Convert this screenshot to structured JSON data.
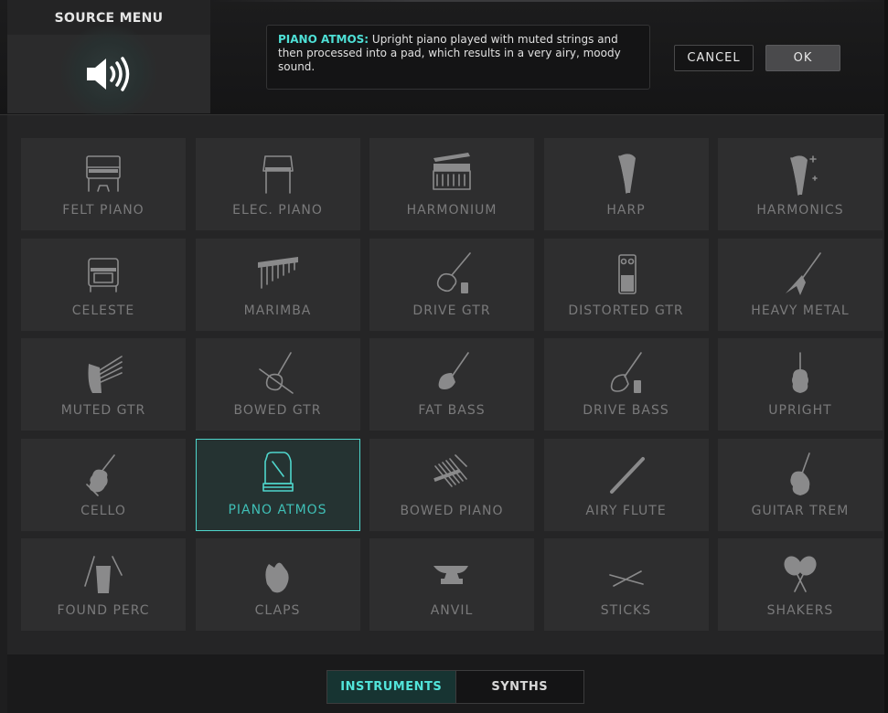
{
  "header": {
    "source_title": "SOURCE MENU",
    "source_icon": "speaker-icon",
    "description_name": "PIANO ATMOS:",
    "description_text": " Upright piano played with muted strings and then processed into a pad, which results in a very airy, moody sound.",
    "cancel_label": "CANCEL",
    "ok_label": "OK"
  },
  "grid": {
    "selected": "PIANO ATMOS",
    "tiles": [
      {
        "label": "FELT PIANO",
        "icon": "upright-piano-icon"
      },
      {
        "label": "ELEC. PIANO",
        "icon": "electric-piano-icon"
      },
      {
        "label": "HARMONIUM",
        "icon": "harmonium-icon"
      },
      {
        "label": "HARP",
        "icon": "harp-icon"
      },
      {
        "label": "HARMONICS",
        "icon": "harp-sparkle-icon"
      },
      {
        "label": "CELESTE",
        "icon": "celeste-icon"
      },
      {
        "label": "MARIMBA",
        "icon": "marimba-icon"
      },
      {
        "label": "DRIVE GTR",
        "icon": "electric-guitar-pedal-icon"
      },
      {
        "label": "DISTORTED GTR",
        "icon": "distortion-pedal-icon"
      },
      {
        "label": "HEAVY METAL",
        "icon": "flying-v-guitar-icon"
      },
      {
        "label": "MUTED GTR",
        "icon": "hand-strings-icon"
      },
      {
        "label": "BOWED GTR",
        "icon": "guitar-bow-icon"
      },
      {
        "label": "FAT BASS",
        "icon": "bass-guitar-icon"
      },
      {
        "label": "DRIVE BASS",
        "icon": "bass-pedal-icon"
      },
      {
        "label": "UPRIGHT",
        "icon": "double-bass-icon"
      },
      {
        "label": "CELLO",
        "icon": "cello-icon"
      },
      {
        "label": "PIANO ATMOS",
        "icon": "grand-piano-icon"
      },
      {
        "label": "BOWED PIANO",
        "icon": "piano-hammers-icon"
      },
      {
        "label": "AIRY FLUTE",
        "icon": "flute-icon"
      },
      {
        "label": "GUITAR TREM",
        "icon": "hollow-guitar-icon"
      },
      {
        "label": "FOUND PERC",
        "icon": "cup-sticks-icon"
      },
      {
        "label": "CLAPS",
        "icon": "clapping-hands-icon"
      },
      {
        "label": "ANVIL",
        "icon": "anvil-icon"
      },
      {
        "label": "STICKS",
        "icon": "drumsticks-icon"
      },
      {
        "label": "SHAKERS",
        "icon": "maracas-icon"
      }
    ]
  },
  "tabs": {
    "instruments": "INSTRUMENTS",
    "synths": "SYNTHS",
    "active": "INSTRUMENTS"
  },
  "colors": {
    "accent": "#4fd6cc",
    "tile_bg": "#2e2e2f",
    "label": "#7a7a7b"
  }
}
